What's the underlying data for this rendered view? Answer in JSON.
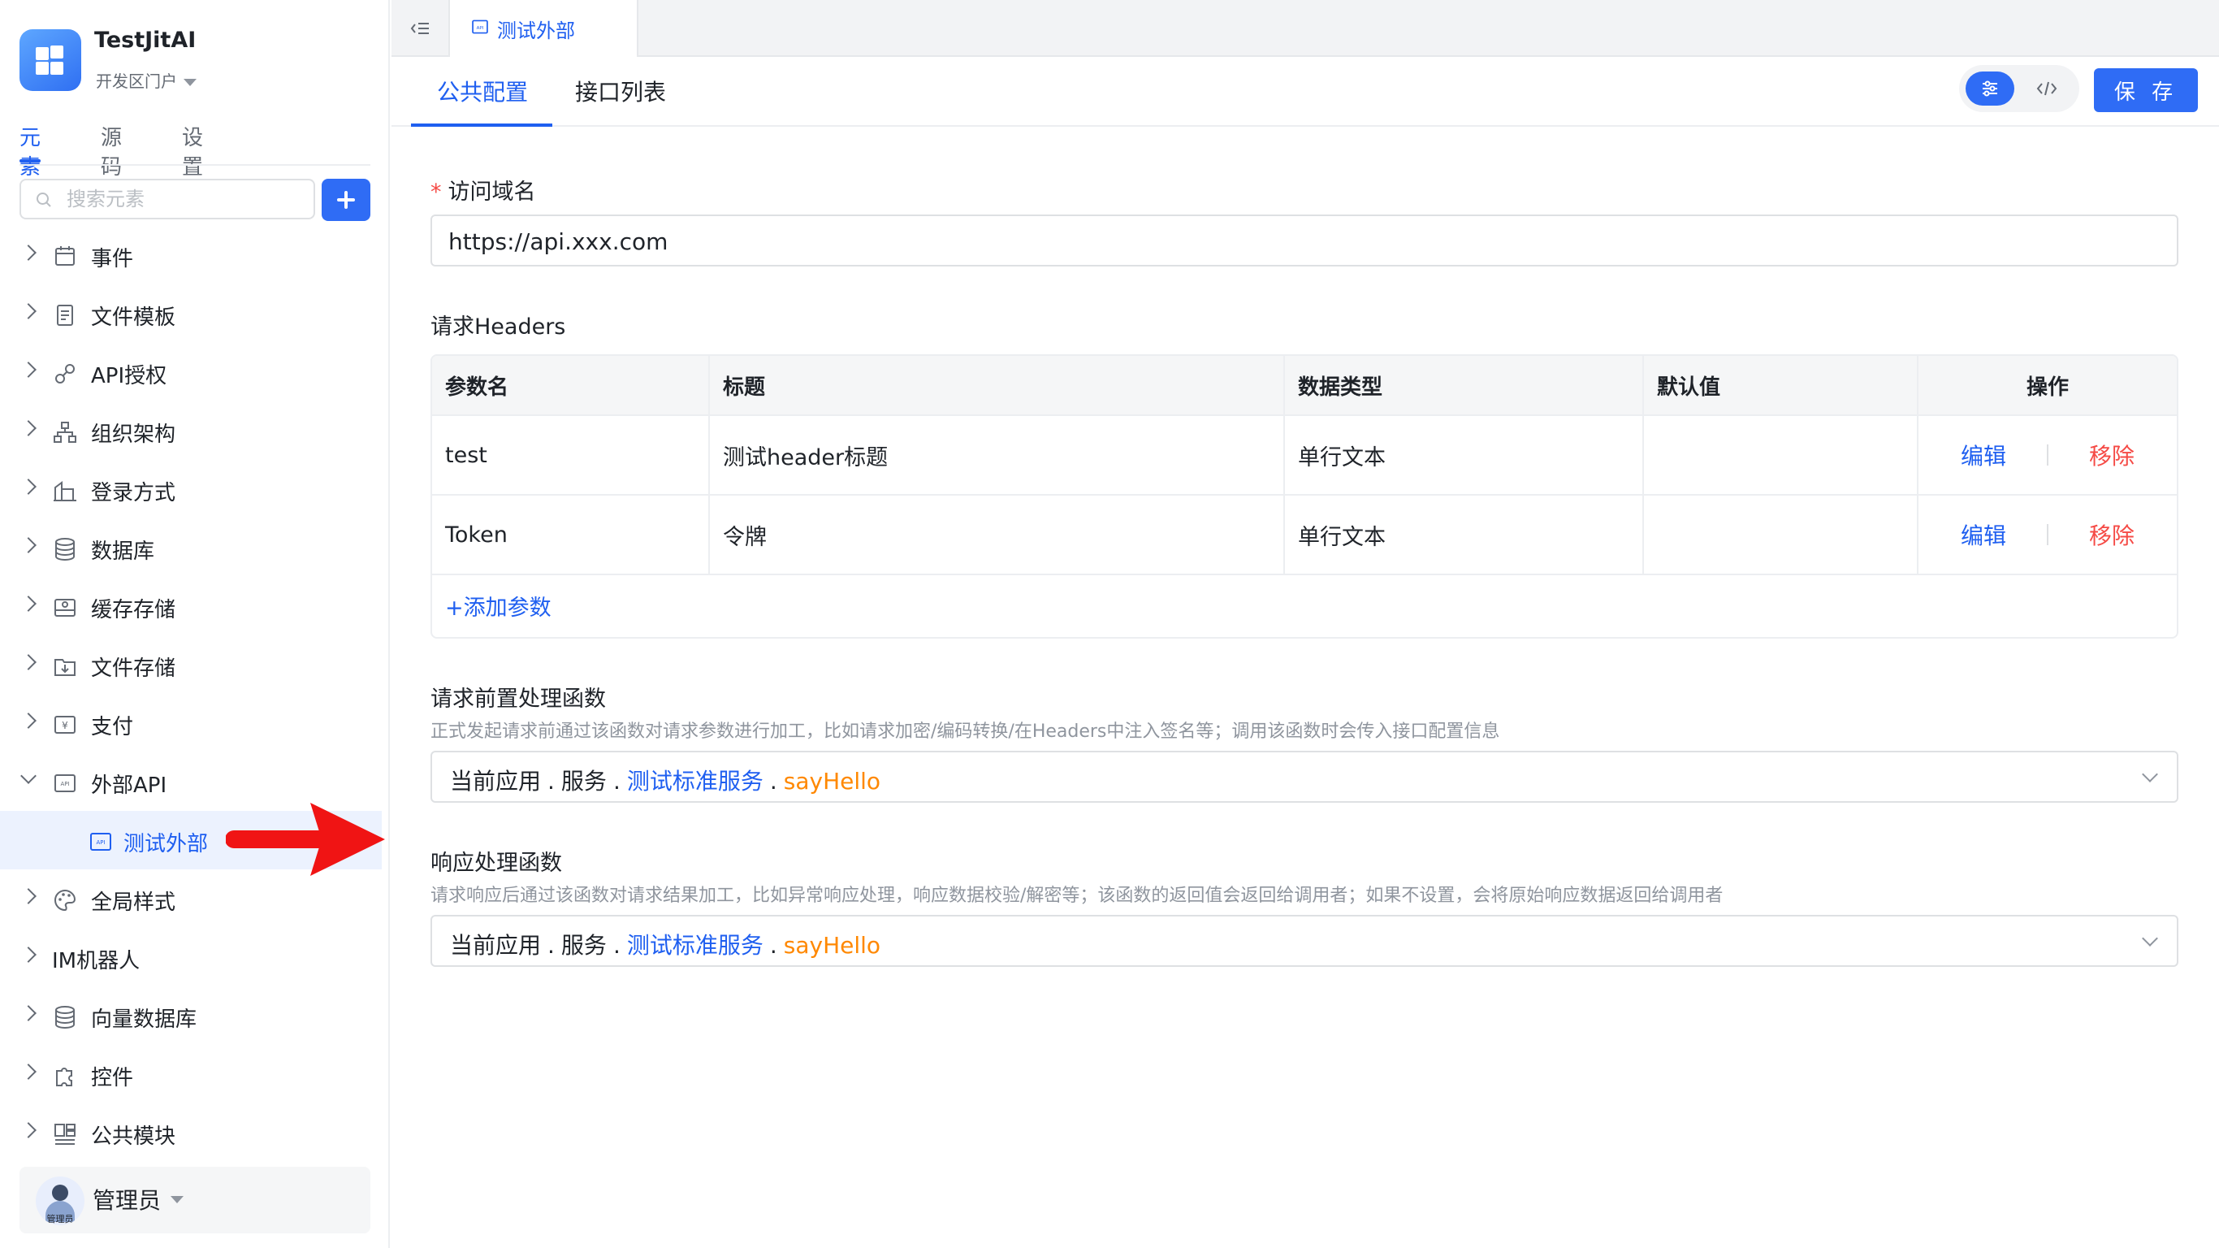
{
  "app": {
    "name": "TestJitAI",
    "portal": "开发区门户"
  },
  "sidebar": {
    "tabs": [
      {
        "label": "元素",
        "active": true
      },
      {
        "label": "源码",
        "active": false
      },
      {
        "label": "设置",
        "active": false
      }
    ],
    "search_placeholder": "搜索元素",
    "items": [
      {
        "label": "事件",
        "icon": "event-icon"
      },
      {
        "label": "文件模板",
        "icon": "file-template-icon"
      },
      {
        "label": "API授权",
        "icon": "link-icon"
      },
      {
        "label": "组织架构",
        "icon": "org-chart-icon"
      },
      {
        "label": "登录方式",
        "icon": "login-icon"
      },
      {
        "label": "数据库",
        "icon": "database-icon"
      },
      {
        "label": "缓存存储",
        "icon": "cache-icon"
      },
      {
        "label": "文件存储",
        "icon": "folder-icon"
      },
      {
        "label": "支付",
        "icon": "payment-icon"
      },
      {
        "label": "外部API",
        "icon": "api-icon",
        "expanded": true
      },
      {
        "label": "测试外部",
        "icon": "api-icon",
        "child": true,
        "selected": true
      },
      {
        "label": "全局样式",
        "icon": "palette-icon"
      },
      {
        "label": "IM机器人",
        "icon": ""
      },
      {
        "label": "向量数据库",
        "icon": "database-icon"
      },
      {
        "label": "控件",
        "icon": "puzzle-icon"
      },
      {
        "label": "公共模块",
        "icon": "module-icon"
      }
    ],
    "user": {
      "name": "管理员",
      "avatar_text": "管理员"
    }
  },
  "topbar": {
    "tab_label": "测试外部"
  },
  "subtabs": [
    {
      "label": "公共配置",
      "active": true
    },
    {
      "label": "接口列表",
      "active": false
    }
  ],
  "toolbar": {
    "save_label": "保 存"
  },
  "form": {
    "domain": {
      "label": "访问域名",
      "required_mark": "*",
      "value": "https://api.xxx.com"
    },
    "headers": {
      "label": "请求Headers",
      "columns": [
        "参数名",
        "标题",
        "数据类型",
        "默认值",
        "操作"
      ],
      "rows": [
        {
          "name": "test",
          "title": "测试header标题",
          "type": "单行文本",
          "default": ""
        },
        {
          "name": "Token",
          "title": "令牌",
          "type": "单行文本",
          "default": ""
        }
      ],
      "edit_label": "编辑",
      "remove_label": "移除",
      "add_label": "+添加参数"
    },
    "pre_func": {
      "title": "请求前置处理函数",
      "desc": "正式发起请求前通过该函数对请求参数进行加工，比如请求加密/编码转换/在Headers中注入签名等；调用该函数时会传入接口配置信息",
      "value": {
        "app": "当前应用",
        "service_group": "服务",
        "service": "测试标准服务",
        "method": "sayHello"
      }
    },
    "resp_func": {
      "title": "响应处理函数",
      "desc": "请求响应后通过该函数对请求结果加工，比如异常响应处理，响应数据校验/解密等；该函数的返回值会返回给调用者；如果不设置，会将原始响应数据返回给调用者",
      "value": {
        "app": "当前应用",
        "service_group": "服务",
        "service": "测试标准服务",
        "method": "sayHello"
      }
    }
  },
  "colors": {
    "accent": "#2f6cf5",
    "danger": "#f54a45",
    "method": "#ff8800",
    "annotation_arrow": "#f01414"
  }
}
